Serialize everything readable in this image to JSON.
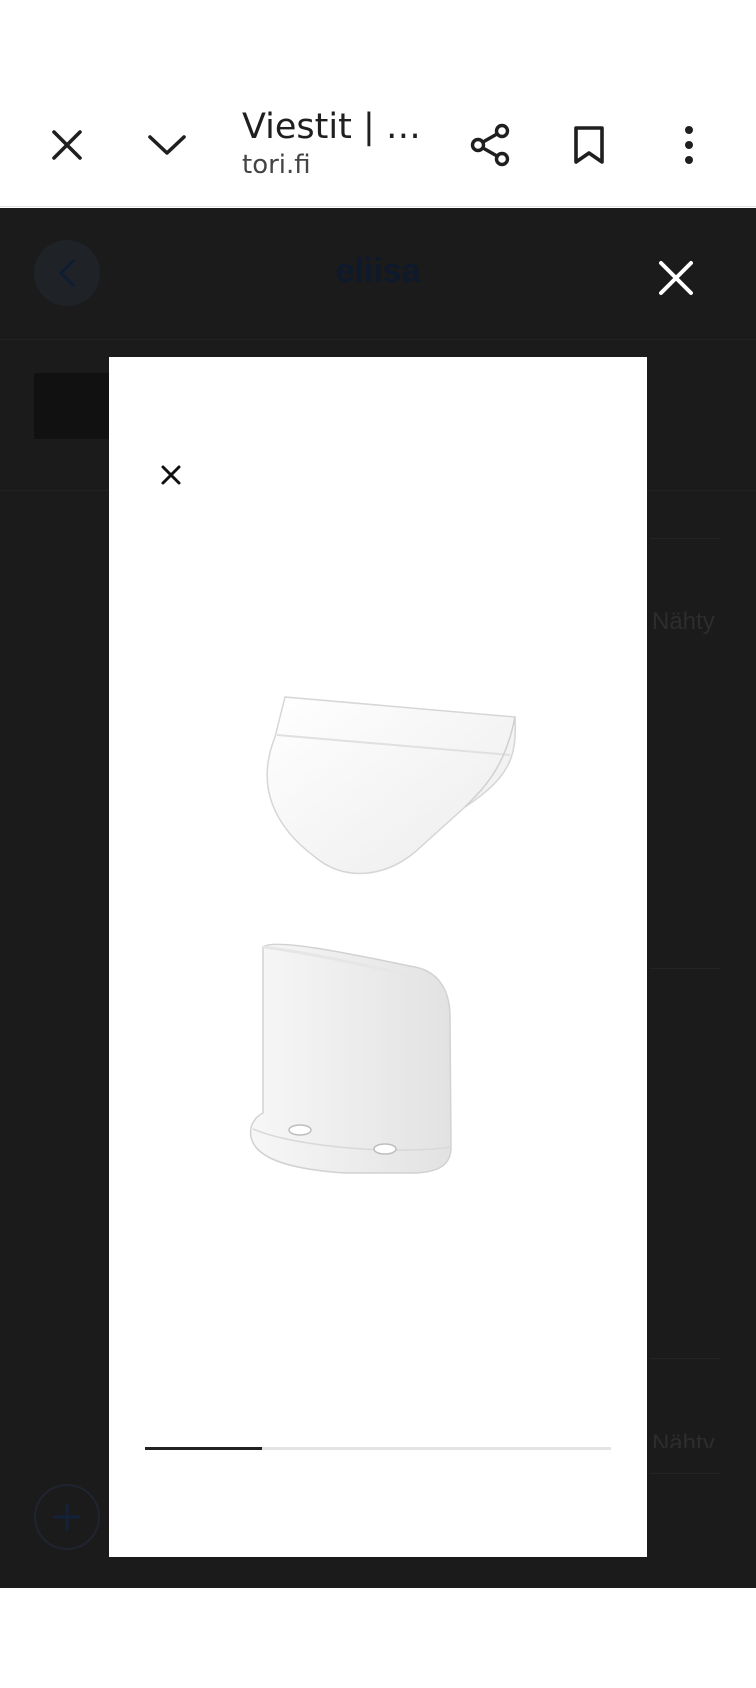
{
  "browser": {
    "title": "Viestit | …",
    "url": "tori.fi",
    "icons": [
      "close-icon",
      "chevron-down-icon",
      "share-icon",
      "bookmark-icon",
      "more-vert-icon"
    ]
  },
  "site": {
    "conversation_name": "eliisa",
    "seen_label": "Nähty",
    "seen_label_partial": "Nähty"
  },
  "gallery": {
    "progress": 0.25,
    "image_subject": "white cabinet handle"
  },
  "colors": {
    "overlay": "#1b1b1b",
    "modal": "#ffffff",
    "progress_fill": "#222222",
    "progress_track": "#e3e3e3"
  }
}
